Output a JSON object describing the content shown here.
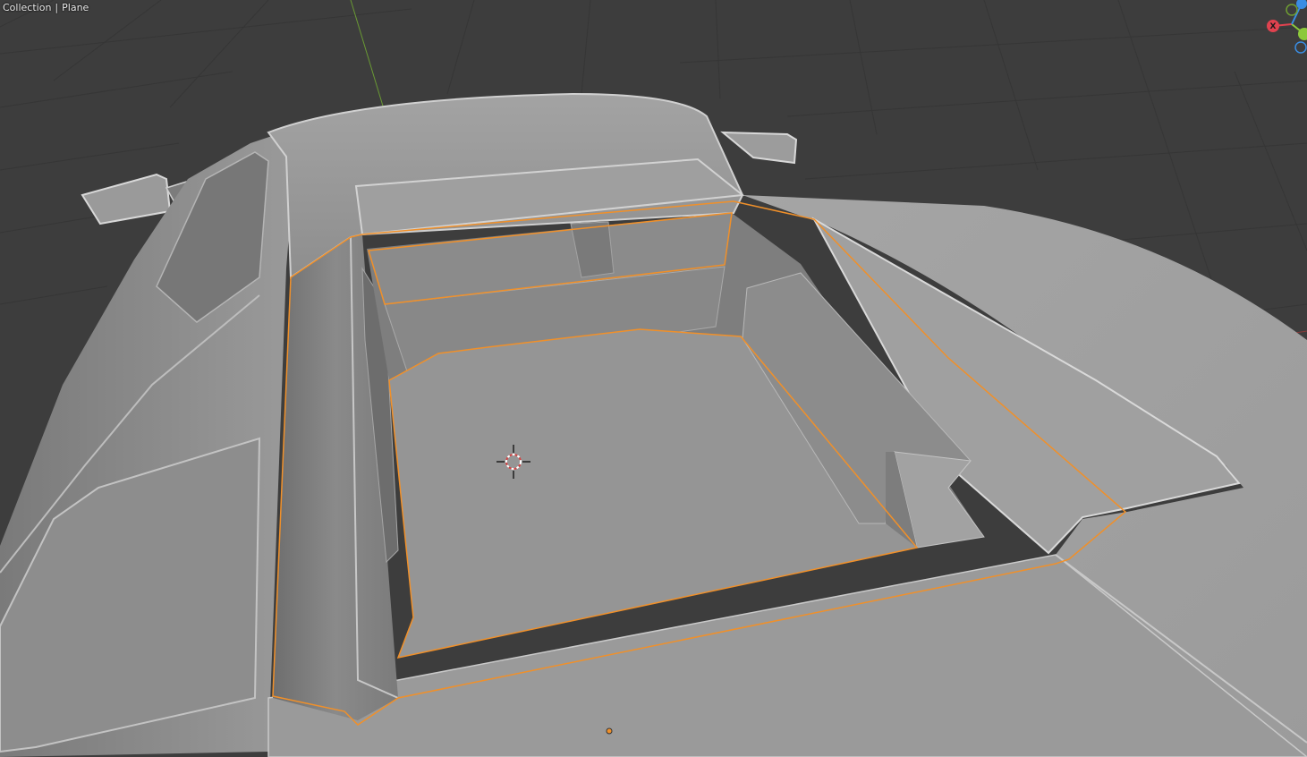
{
  "header": {
    "collection_label": "Collection",
    "separator": "|",
    "object_name": "Plane"
  },
  "gizmo": {
    "x_axis_label": "X",
    "x_color": "#e0424f",
    "y_color": "#8dc93b",
    "z_color": "#3a8de3"
  },
  "colors": {
    "background": "#3d3d3d",
    "grid_line": "#353535",
    "x_axis_line": "#8a3a3a",
    "y_axis_line": "#6a9a34",
    "model_surface": "#8f8f8f",
    "selection_outline": "#f0902a"
  },
  "viewport": {
    "mode": "Object Mode",
    "selected_object": "Plane",
    "cursor_icon": "3d-cursor-icon",
    "origin_icon": "object-origin-icon"
  }
}
